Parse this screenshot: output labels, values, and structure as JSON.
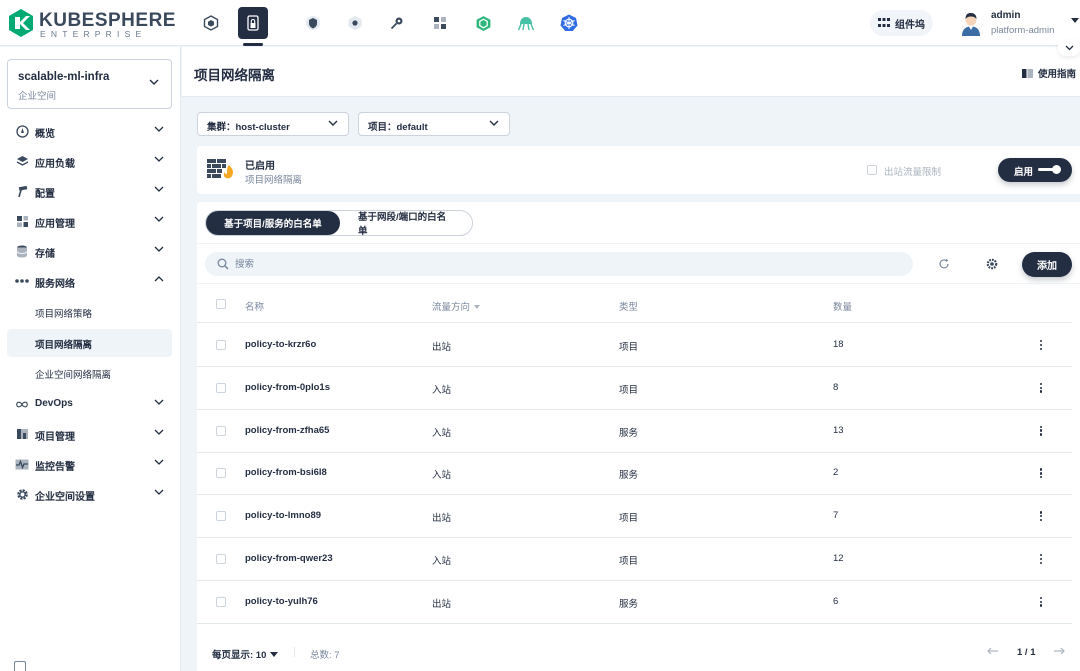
{
  "brand": {
    "name": "KUBESPHERE",
    "edition": "ENTERPRISE",
    "primary_color": "#242e42",
    "logo_green": "#00aa72"
  },
  "topnav": {
    "icons": [
      "cube-icon",
      "lock-icon",
      "shield-icon",
      "hexagon-icon",
      "key-icon",
      "apps-icon",
      "box-icon",
      "octopus-icon",
      "kubernetes-icon"
    ],
    "toolbox_label": "组件坞",
    "user": {
      "name": "admin",
      "role": "platform-admin"
    }
  },
  "sidebar": {
    "workspace": {
      "name": "scalable-ml-infra",
      "type": "企业空间"
    },
    "items": [
      {
        "label": "概览",
        "icon": "dashboard-icon",
        "expanded": false
      },
      {
        "label": "应用负载",
        "icon": "layers-icon",
        "expanded": false
      },
      {
        "label": "配置",
        "icon": "hammer-icon",
        "expanded": false
      },
      {
        "label": "应用管理",
        "icon": "apps-icon",
        "expanded": false
      },
      {
        "label": "存储",
        "icon": "database-icon",
        "expanded": false
      },
      {
        "label": "服务网络",
        "icon": "network-icon",
        "expanded": true
      },
      {
        "label": "DevOps",
        "icon": "infinity-icon",
        "expanded": false
      },
      {
        "label": "项目管理",
        "icon": "project-icon",
        "expanded": false
      },
      {
        "label": "监控告警",
        "icon": "monitor-icon",
        "expanded": false
      },
      {
        "label": "企业空间设置",
        "icon": "gear-icon",
        "expanded": false
      }
    ],
    "subitems": [
      {
        "label": "项目网络策略",
        "active": false
      },
      {
        "label": "项目网络隔离",
        "active": true
      },
      {
        "label": "企业空间网络隔离",
        "active": false
      }
    ]
  },
  "header": {
    "title": "项目网络隔离",
    "guide_label": "使用指南"
  },
  "filters": {
    "cluster": "集群：host-cluster",
    "project": "项目：default"
  },
  "status": {
    "title": "已启用",
    "subtitle": "项目网络隔离",
    "checkbox_label": "出站流量限制",
    "toggle_label": "启用"
  },
  "tabs": [
    {
      "label": "基于项目/服务的白名单",
      "active": true
    },
    {
      "label": "基于网段/端口的白名单",
      "active": false
    }
  ],
  "search": {
    "placeholder": "搜索",
    "value": ""
  },
  "add_label": "添加",
  "table": {
    "columns": [
      "名称",
      "流量方向",
      "类型",
      "数量"
    ],
    "rows": [
      {
        "name": "policy-to-krzr6o",
        "direction": "出站",
        "type": "项目",
        "count": "18"
      },
      {
        "name": "policy-from-0plo1s",
        "direction": "入站",
        "type": "项目",
        "count": "8"
      },
      {
        "name": "policy-from-zfha65",
        "direction": "入站",
        "type": "服务",
        "count": "13"
      },
      {
        "name": "policy-from-bsi6l8",
        "direction": "入站",
        "type": "服务",
        "count": "2"
      },
      {
        "name": "policy-to-lmno89",
        "direction": "出站",
        "type": "项目",
        "count": "7"
      },
      {
        "name": "policy-from-qwer23",
        "direction": "入站",
        "type": "项目",
        "count": "12"
      },
      {
        "name": "policy-to-yulh76",
        "direction": "出站",
        "type": "服务",
        "count": "6"
      }
    ]
  },
  "pagination": {
    "page_size_label": "每页显示: 10",
    "total_label": "总数: 7",
    "page_label": "1 / 1"
  }
}
